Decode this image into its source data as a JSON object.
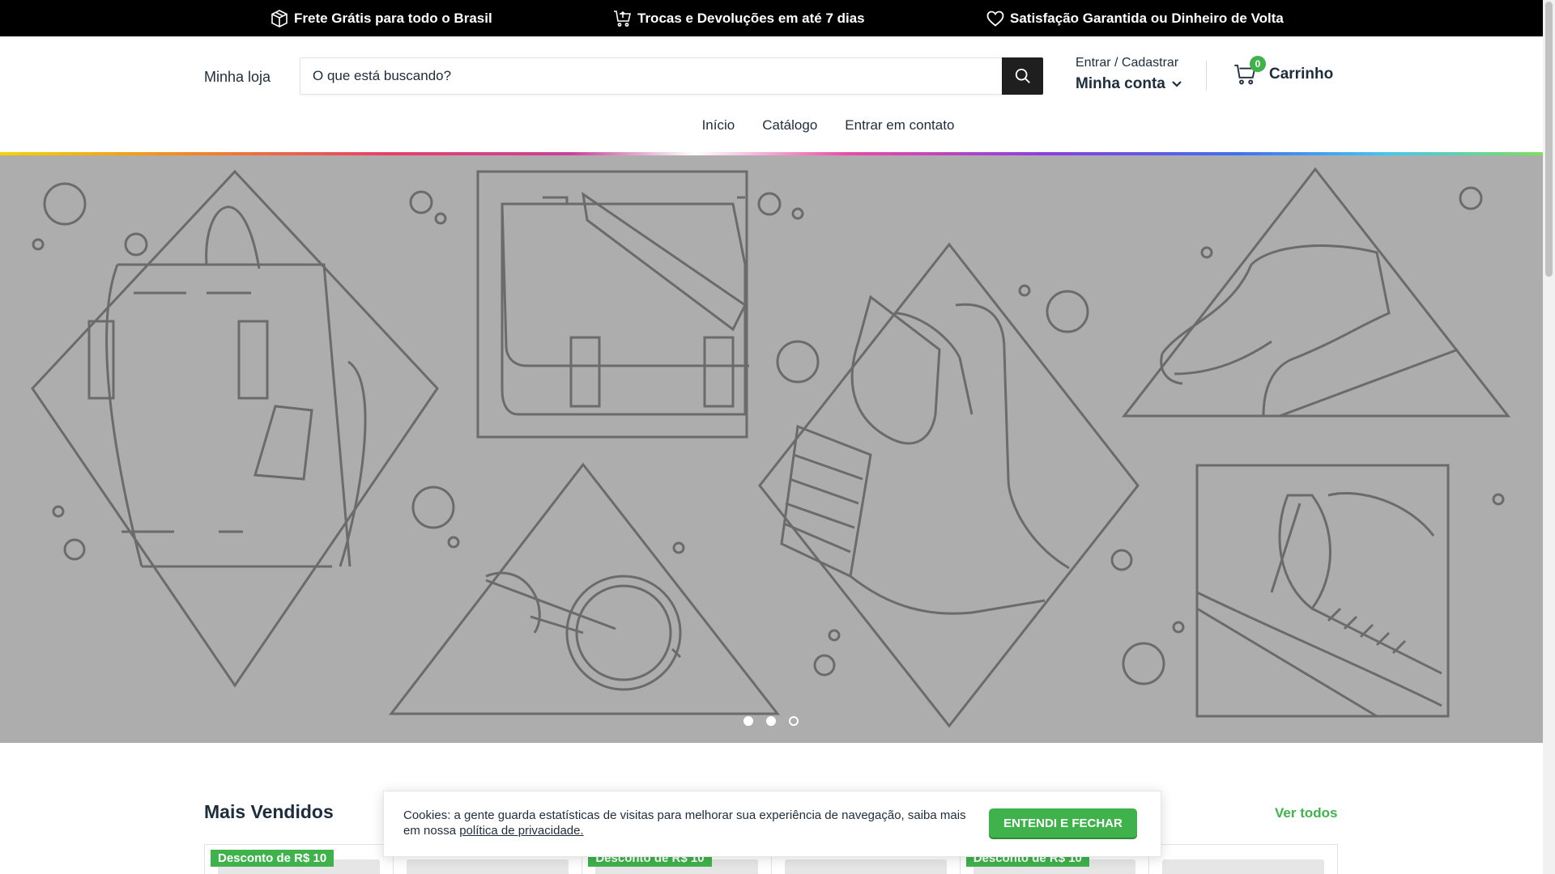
{
  "announcement": {
    "items": [
      {
        "icon": "box-icon",
        "text": "Frete Grátis para todo o Brasil"
      },
      {
        "icon": "cart-return-icon",
        "text": "Trocas e Devoluções em até 7 dias"
      },
      {
        "icon": "heart-icon",
        "text": "Satisfação Garantida ou Dinheiro de Volta"
      }
    ]
  },
  "header": {
    "store_name": "Minha loja",
    "search": {
      "placeholder": "O que está buscando?"
    },
    "account": {
      "small": "Entrar / Cadastrar",
      "big": "Minha conta"
    },
    "cart": {
      "count": "0",
      "label": "Carrinho"
    }
  },
  "nav": {
    "items": [
      {
        "label": "Início"
      },
      {
        "label": "Catálogo"
      },
      {
        "label": "Entrar em contato"
      }
    ]
  },
  "hero": {
    "slide_count": 3,
    "active_slide": 3
  },
  "section": {
    "title": "Mais Vendidos",
    "view_all": "Ver todos"
  },
  "products": [
    {
      "badge": "Desconto de R$ 10"
    },
    {
      "badge": ""
    },
    {
      "badge": "Desconto de R$ 10"
    },
    {
      "badge": ""
    },
    {
      "badge": "Desconto de R$ 10"
    },
    {
      "badge": ""
    }
  ],
  "cookie": {
    "text": "Cookies: a gente guarda estatísticas de visitas para melhorar sua experiência de navegação, saiba mais em nossa",
    "link": "política de privacidade.",
    "button": "ENTENDI E FECHAR"
  },
  "colors": {
    "accent": "#3fb24b",
    "announcement_bg": "#000000",
    "hero_bg": "#adadad"
  }
}
